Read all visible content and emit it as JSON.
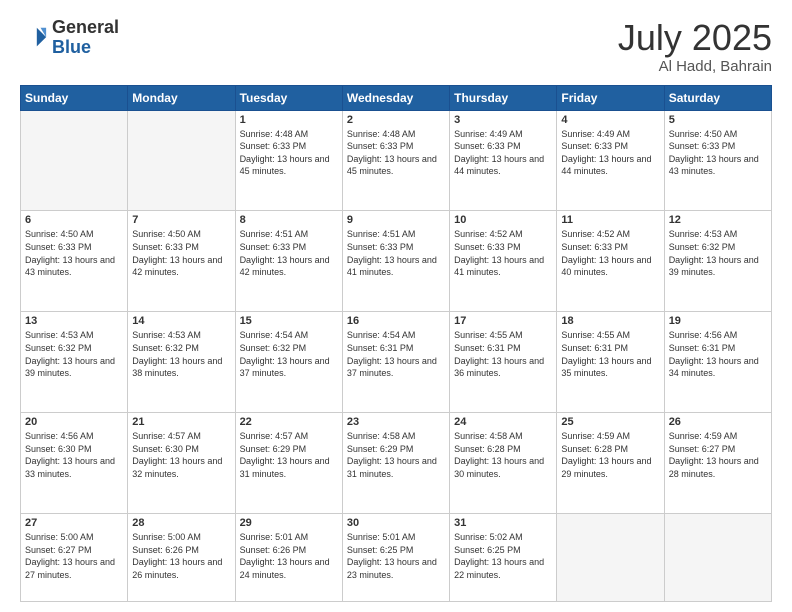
{
  "header": {
    "logo_general": "General",
    "logo_blue": "Blue",
    "month": "July 2025",
    "location": "Al Hadd, Bahrain"
  },
  "weekdays": [
    "Sunday",
    "Monday",
    "Tuesday",
    "Wednesday",
    "Thursday",
    "Friday",
    "Saturday"
  ],
  "weeks": [
    [
      {
        "day": "",
        "sunrise": "",
        "sunset": "",
        "daylight": ""
      },
      {
        "day": "",
        "sunrise": "",
        "sunset": "",
        "daylight": ""
      },
      {
        "day": "1",
        "sunrise": "Sunrise: 4:48 AM",
        "sunset": "Sunset: 6:33 PM",
        "daylight": "Daylight: 13 hours and 45 minutes."
      },
      {
        "day": "2",
        "sunrise": "Sunrise: 4:48 AM",
        "sunset": "Sunset: 6:33 PM",
        "daylight": "Daylight: 13 hours and 45 minutes."
      },
      {
        "day": "3",
        "sunrise": "Sunrise: 4:49 AM",
        "sunset": "Sunset: 6:33 PM",
        "daylight": "Daylight: 13 hours and 44 minutes."
      },
      {
        "day": "4",
        "sunrise": "Sunrise: 4:49 AM",
        "sunset": "Sunset: 6:33 PM",
        "daylight": "Daylight: 13 hours and 44 minutes."
      },
      {
        "day": "5",
        "sunrise": "Sunrise: 4:50 AM",
        "sunset": "Sunset: 6:33 PM",
        "daylight": "Daylight: 13 hours and 43 minutes."
      }
    ],
    [
      {
        "day": "6",
        "sunrise": "Sunrise: 4:50 AM",
        "sunset": "Sunset: 6:33 PM",
        "daylight": "Daylight: 13 hours and 43 minutes."
      },
      {
        "day": "7",
        "sunrise": "Sunrise: 4:50 AM",
        "sunset": "Sunset: 6:33 PM",
        "daylight": "Daylight: 13 hours and 42 minutes."
      },
      {
        "day": "8",
        "sunrise": "Sunrise: 4:51 AM",
        "sunset": "Sunset: 6:33 PM",
        "daylight": "Daylight: 13 hours and 42 minutes."
      },
      {
        "day": "9",
        "sunrise": "Sunrise: 4:51 AM",
        "sunset": "Sunset: 6:33 PM",
        "daylight": "Daylight: 13 hours and 41 minutes."
      },
      {
        "day": "10",
        "sunrise": "Sunrise: 4:52 AM",
        "sunset": "Sunset: 6:33 PM",
        "daylight": "Daylight: 13 hours and 41 minutes."
      },
      {
        "day": "11",
        "sunrise": "Sunrise: 4:52 AM",
        "sunset": "Sunset: 6:33 PM",
        "daylight": "Daylight: 13 hours and 40 minutes."
      },
      {
        "day": "12",
        "sunrise": "Sunrise: 4:53 AM",
        "sunset": "Sunset: 6:32 PM",
        "daylight": "Daylight: 13 hours and 39 minutes."
      }
    ],
    [
      {
        "day": "13",
        "sunrise": "Sunrise: 4:53 AM",
        "sunset": "Sunset: 6:32 PM",
        "daylight": "Daylight: 13 hours and 39 minutes."
      },
      {
        "day": "14",
        "sunrise": "Sunrise: 4:53 AM",
        "sunset": "Sunset: 6:32 PM",
        "daylight": "Daylight: 13 hours and 38 minutes."
      },
      {
        "day": "15",
        "sunrise": "Sunrise: 4:54 AM",
        "sunset": "Sunset: 6:32 PM",
        "daylight": "Daylight: 13 hours and 37 minutes."
      },
      {
        "day": "16",
        "sunrise": "Sunrise: 4:54 AM",
        "sunset": "Sunset: 6:31 PM",
        "daylight": "Daylight: 13 hours and 37 minutes."
      },
      {
        "day": "17",
        "sunrise": "Sunrise: 4:55 AM",
        "sunset": "Sunset: 6:31 PM",
        "daylight": "Daylight: 13 hours and 36 minutes."
      },
      {
        "day": "18",
        "sunrise": "Sunrise: 4:55 AM",
        "sunset": "Sunset: 6:31 PM",
        "daylight": "Daylight: 13 hours and 35 minutes."
      },
      {
        "day": "19",
        "sunrise": "Sunrise: 4:56 AM",
        "sunset": "Sunset: 6:31 PM",
        "daylight": "Daylight: 13 hours and 34 minutes."
      }
    ],
    [
      {
        "day": "20",
        "sunrise": "Sunrise: 4:56 AM",
        "sunset": "Sunset: 6:30 PM",
        "daylight": "Daylight: 13 hours and 33 minutes."
      },
      {
        "day": "21",
        "sunrise": "Sunrise: 4:57 AM",
        "sunset": "Sunset: 6:30 PM",
        "daylight": "Daylight: 13 hours and 32 minutes."
      },
      {
        "day": "22",
        "sunrise": "Sunrise: 4:57 AM",
        "sunset": "Sunset: 6:29 PM",
        "daylight": "Daylight: 13 hours and 31 minutes."
      },
      {
        "day": "23",
        "sunrise": "Sunrise: 4:58 AM",
        "sunset": "Sunset: 6:29 PM",
        "daylight": "Daylight: 13 hours and 31 minutes."
      },
      {
        "day": "24",
        "sunrise": "Sunrise: 4:58 AM",
        "sunset": "Sunset: 6:28 PM",
        "daylight": "Daylight: 13 hours and 30 minutes."
      },
      {
        "day": "25",
        "sunrise": "Sunrise: 4:59 AM",
        "sunset": "Sunset: 6:28 PM",
        "daylight": "Daylight: 13 hours and 29 minutes."
      },
      {
        "day": "26",
        "sunrise": "Sunrise: 4:59 AM",
        "sunset": "Sunset: 6:27 PM",
        "daylight": "Daylight: 13 hours and 28 minutes."
      }
    ],
    [
      {
        "day": "27",
        "sunrise": "Sunrise: 5:00 AM",
        "sunset": "Sunset: 6:27 PM",
        "daylight": "Daylight: 13 hours and 27 minutes."
      },
      {
        "day": "28",
        "sunrise": "Sunrise: 5:00 AM",
        "sunset": "Sunset: 6:26 PM",
        "daylight": "Daylight: 13 hours and 26 minutes."
      },
      {
        "day": "29",
        "sunrise": "Sunrise: 5:01 AM",
        "sunset": "Sunset: 6:26 PM",
        "daylight": "Daylight: 13 hours and 24 minutes."
      },
      {
        "day": "30",
        "sunrise": "Sunrise: 5:01 AM",
        "sunset": "Sunset: 6:25 PM",
        "daylight": "Daylight: 13 hours and 23 minutes."
      },
      {
        "day": "31",
        "sunrise": "Sunrise: 5:02 AM",
        "sunset": "Sunset: 6:25 PM",
        "daylight": "Daylight: 13 hours and 22 minutes."
      },
      {
        "day": "",
        "sunrise": "",
        "sunset": "",
        "daylight": ""
      },
      {
        "day": "",
        "sunrise": "",
        "sunset": "",
        "daylight": ""
      }
    ]
  ]
}
